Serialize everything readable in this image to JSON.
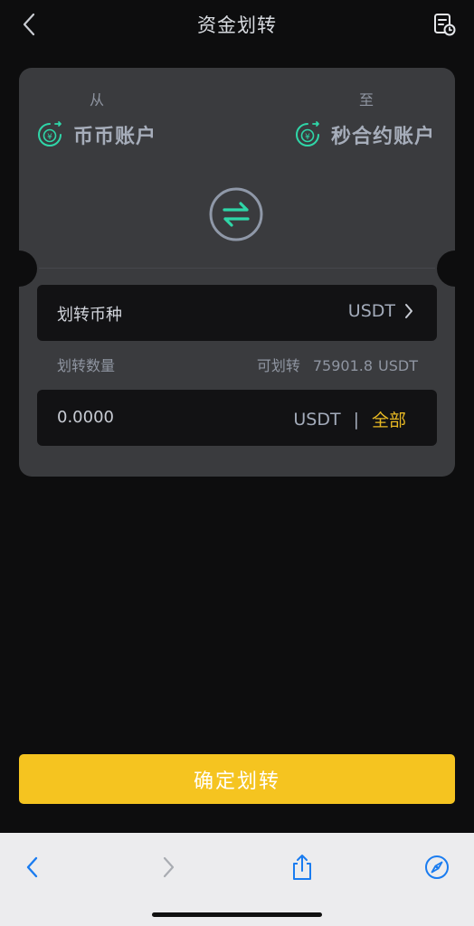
{
  "header": {
    "title": "资金划转"
  },
  "transfer": {
    "from_label": "从",
    "to_label": "至",
    "from_account": "币币账户",
    "to_account": "秒合约账户"
  },
  "coin": {
    "label": "划转币种",
    "value": "USDT"
  },
  "quantity": {
    "label": "划转数量",
    "available_label": "可划转",
    "available_value": "75901.8",
    "available_unit": "USDT"
  },
  "amount": {
    "value": "0.0000",
    "unit": "USDT",
    "separator": "|",
    "all_label": "全部"
  },
  "confirm": {
    "label": "确定划转"
  },
  "colors": {
    "accent": "#f5c420",
    "swap_icon": "#2fd6a8",
    "link": "#1a7cf0"
  },
  "icons": [
    "back-icon",
    "history-icon",
    "account-icon",
    "swap-icon",
    "chevron-right-icon",
    "share-icon",
    "safari-compass-icon"
  ]
}
